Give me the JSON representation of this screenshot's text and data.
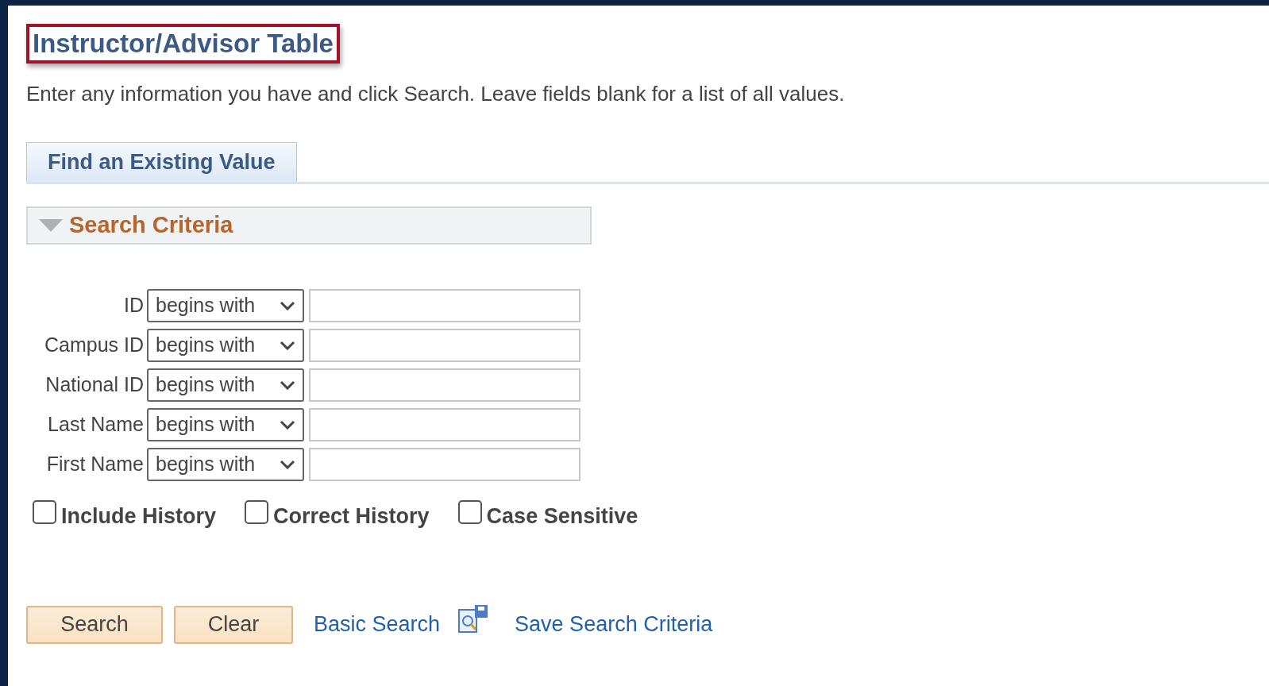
{
  "page_title": "Instructor/Advisor Table",
  "instructions": "Enter any information you have and click Search. Leave fields blank for a list of all values.",
  "tabs": [
    {
      "label": "Find an Existing Value",
      "selected": true
    }
  ],
  "section": {
    "title": "Search Criteria",
    "expanded": true
  },
  "fields": [
    {
      "label": "ID",
      "operator": "begins with"
    },
    {
      "label": "Campus ID",
      "operator": "begins with"
    },
    {
      "label": "National ID",
      "operator": "begins with"
    },
    {
      "label": "Last Name",
      "operator": "begins with"
    },
    {
      "label": "First Name",
      "operator": "begins with"
    }
  ],
  "options": [
    {
      "label": "Include History",
      "checked": false
    },
    {
      "label": "Correct History",
      "checked": false
    },
    {
      "label": "Case Sensitive",
      "checked": false
    }
  ],
  "buttons": [
    "Search",
    "Clear"
  ],
  "links": [
    {
      "label": "Basic Search",
      "kind": "link"
    },
    {
      "label": "Save Search Criteria",
      "kind": "icon-link"
    }
  ]
}
